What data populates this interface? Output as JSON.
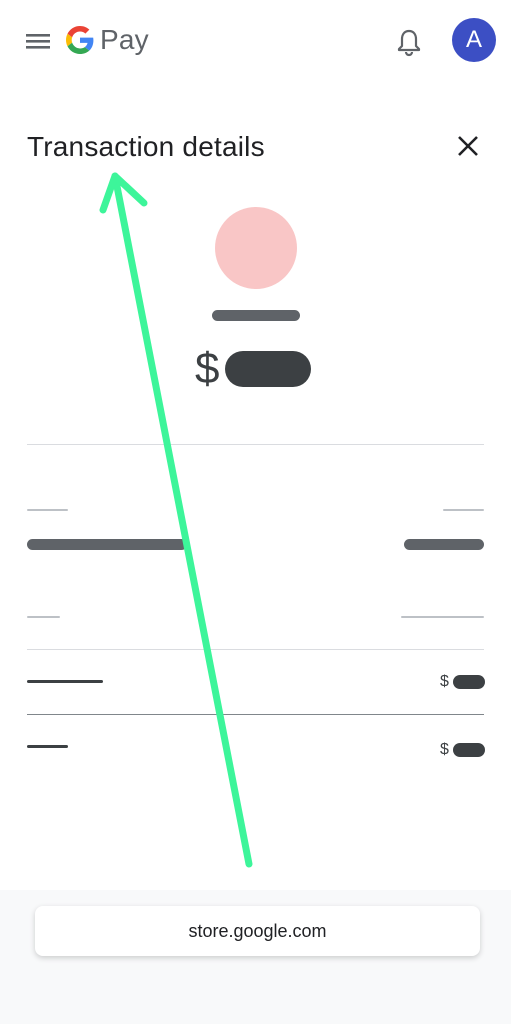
{
  "header": {
    "app_name_suffix": "Pay",
    "avatar_initial": "A"
  },
  "title": "Transaction details",
  "amount": {
    "currency_symbol": "$"
  },
  "rows": [
    {
      "currency_symbol": "$"
    },
    {
      "currency_symbol": "$"
    }
  ],
  "browser": {
    "url": "store.google.com"
  },
  "colors": {
    "avatar_bg": "#3c4fc4",
    "merchant_avatar": "#f9c6c6",
    "annotation_arrow": "#3df59a"
  },
  "icons": [
    "menu-icon",
    "google-g-logo",
    "bell-icon",
    "close-icon"
  ]
}
